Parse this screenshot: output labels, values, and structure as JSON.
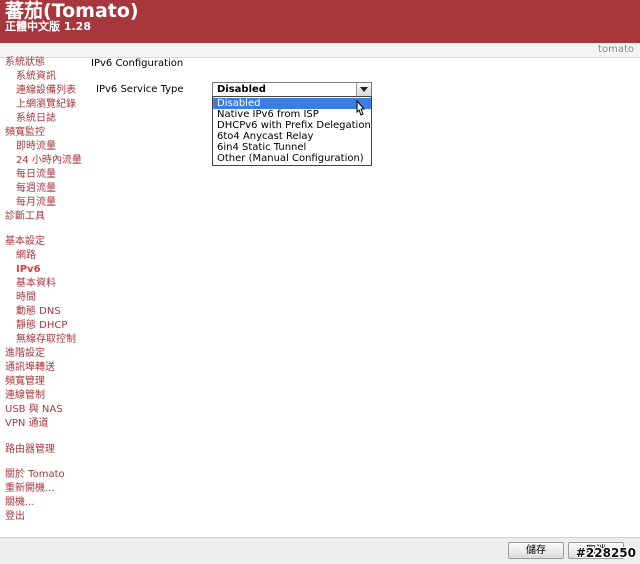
{
  "header": {
    "title": "蕃茄(Tomato)",
    "subtitle": "正體中文版 1.28",
    "router_name": "tomato"
  },
  "sidebar": {
    "items": [
      {
        "label": "系統狀態"
      },
      {
        "label": "系統資訊"
      },
      {
        "label": "連線設備列表"
      },
      {
        "label": "上網瀏覽紀錄"
      },
      {
        "label": "系統日誌"
      },
      {
        "label": "頻寬監控"
      },
      {
        "label": "即時流量"
      },
      {
        "label": "24 小時內流量"
      },
      {
        "label": "每日流量"
      },
      {
        "label": "每週流量"
      },
      {
        "label": "每月流量"
      },
      {
        "label": "診斷工具"
      },
      {
        "label": "基本設定"
      },
      {
        "label": "網路"
      },
      {
        "label": "IPv6"
      },
      {
        "label": "基本資料"
      },
      {
        "label": "時間"
      },
      {
        "label": "動態 DNS"
      },
      {
        "label": "靜態 DHCP"
      },
      {
        "label": "無線存取控制"
      },
      {
        "label": "進階設定"
      },
      {
        "label": "通訊埠轉送"
      },
      {
        "label": "頻寬管理"
      },
      {
        "label": "連線管制"
      },
      {
        "label": "USB 與 NAS"
      },
      {
        "label": "VPN 通道"
      },
      {
        "label": "路由器管理"
      },
      {
        "label": "關於 Tomato"
      },
      {
        "label": "重新開機..."
      },
      {
        "label": "關機..."
      },
      {
        "label": "登出"
      }
    ],
    "active": "IPv6"
  },
  "main": {
    "section_title": "IPv6 Configuration",
    "field_label": "IPv6 Service Type",
    "select": {
      "value": "Disabled",
      "options": [
        "Disabled",
        "Native IPv6 from ISP",
        "DHCPv6 with Prefix Delegation",
        "6to4 Anycast Relay",
        "6in4 Static Tunnel",
        "Other (Manual Configuration)"
      ]
    }
  },
  "footer": {
    "save_label": "儲存",
    "cancel_label": "取消"
  },
  "watermark": "#228250"
}
